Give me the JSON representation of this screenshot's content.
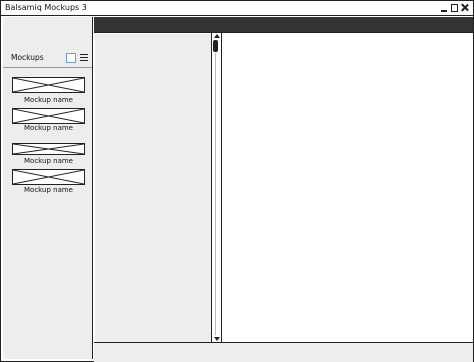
{
  "window": {
    "title": "Balsamiq Mockups 3"
  },
  "sidebar": {
    "title": "Mockups",
    "items": [
      {
        "label": "Mockup name"
      },
      {
        "label": "Mockup name"
      },
      {
        "label": "Mockup name"
      },
      {
        "label": "Mockup name"
      }
    ]
  },
  "colors": {
    "toolbar": "#333333",
    "panel": "#ededed",
    "grid_icon_accent": "#6a9fd8"
  }
}
